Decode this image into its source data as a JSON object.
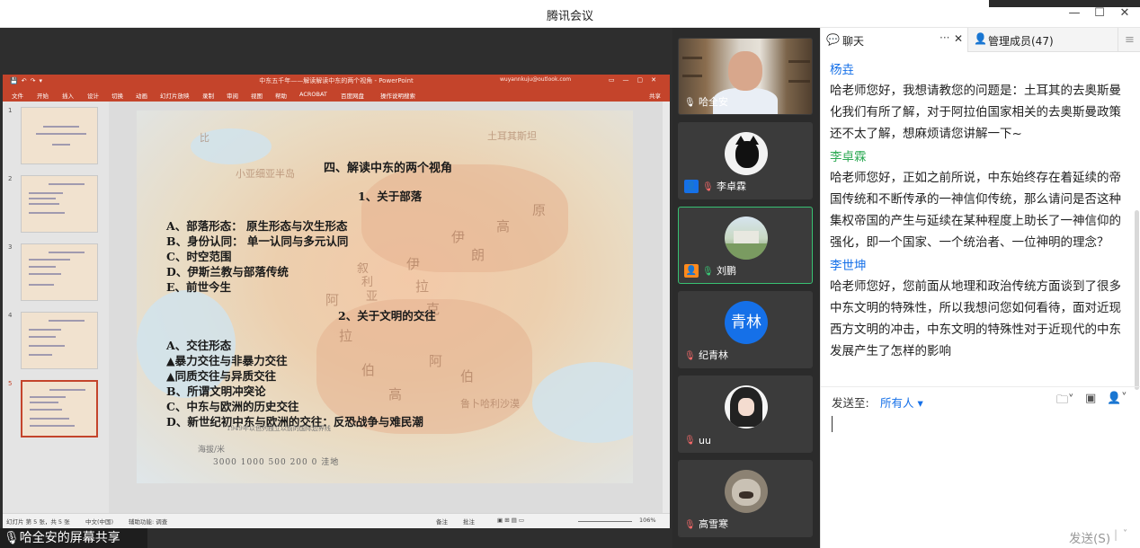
{
  "window": {
    "title": "腾讯会议"
  },
  "ppt": {
    "title": "中东五千年——解读解读中东的两个视角 - PowerPoint",
    "account": "wuyannkuju@outlook.com",
    "ribbon": [
      "文件",
      "开始",
      "插入",
      "设计",
      "切换",
      "动画",
      "幻灯片放映",
      "录制",
      "审阅",
      "视图",
      "帮助",
      "ACROBAT",
      "百度网盘",
      "操作说明搜索"
    ],
    "ribbon_share": "共享",
    "thumbs": [
      "1",
      "2",
      "3",
      "4",
      "5"
    ],
    "status": {
      "slide": "幻灯片 第 5 张，共 5 张",
      "lang": "中文(中国)",
      "access": "辅助功能: 调查",
      "notes": "备注",
      "comments": "批注",
      "zoom": "106%"
    },
    "slide": {
      "heading": "四、解读中东的两个视角",
      "sub1": "1、关于部落",
      "items1": [
        "A、部落形态：  原生形态与次生形态",
        "B、身份认同：  单一认同与多元认同",
        "C、时空范围",
        "D、伊斯兰教与部落传统",
        "E、前世今生"
      ],
      "sub2": "2、关于文明的交往",
      "items2": [
        "A、交往形态",
        "▲暴力交往与非暴力交往",
        "▲同质交往与异质交往",
        "B、所谓文明冲突论",
        "C、中东与欧洲的历史交往",
        "D、新世纪初中东与欧洲的交往：反恐战争与难民潮"
      ],
      "map_labels": [
        "土耳其斯坦",
        "小亚细亚半岛",
        "伊",
        "朗",
        "高",
        "原",
        "阿",
        "拉",
        "伯",
        "伊",
        "拉",
        "克",
        "叙",
        "利",
        "亚",
        "阿",
        "伯",
        "高",
        "鲁卜哈利沙漠",
        "比"
      ],
      "legend_title": "海拔/米",
      "legend": "3000  1000  500   200    0  洼地",
      "legend_note": "1949年以色列独立以前的国际边界线"
    }
  },
  "share_label": "哈全安的屏幕共享",
  "participants": [
    {
      "name": "哈全安",
      "type": "video",
      "mic": "on"
    },
    {
      "name": "李卓霖",
      "type": "cat",
      "mic": "off",
      "badge": true
    },
    {
      "name": "刘鹏",
      "type": "landscape",
      "mic": "on",
      "badge": true,
      "active": true
    },
    {
      "name": "纪青林",
      "type": "text",
      "avatar_text": "青林",
      "mic": "off"
    },
    {
      "name": "uu",
      "type": "anime",
      "mic": "off"
    },
    {
      "name": "高雪寒",
      "type": "animal",
      "mic": "off"
    }
  ],
  "chat": {
    "tab_chat": "聊天",
    "tab_members": "管理成员(47)",
    "messages": [
      {
        "sender": "杨垚",
        "color": "#1570e8",
        "text": "哈老师您好，我想请教您的问题是：土耳其的去奥斯曼化我们有所了解，对于阿拉伯国家相关的去奥斯曼政策还不太了解，想麻烦请您讲解一下~"
      },
      {
        "sender": "李卓霖",
        "color": "#2eaa55",
        "text": "哈老师您好，正如之前所说，中东始终存在着延续的帝国传统和不断传承的一神信仰传统，那么请问是否这种集权帝国的产生与延续在某种程度上助长了一神信仰的强化，即一个国家、一个统治者、一位神明的理念？"
      },
      {
        "sender": "李世坤",
        "color": "#1570e8",
        "text": "哈老师您好，您前面从地理和政治传统方面谈到了很多中东文明的特殊性，所以我想问您如何看待，面对近现西方文明的冲击，中东文明的特殊性对于近现代的中东发展产生了怎样的影响"
      }
    ],
    "send_to_label": "发送至:",
    "send_to_value": "所有人",
    "send_button": "发送(S)"
  }
}
